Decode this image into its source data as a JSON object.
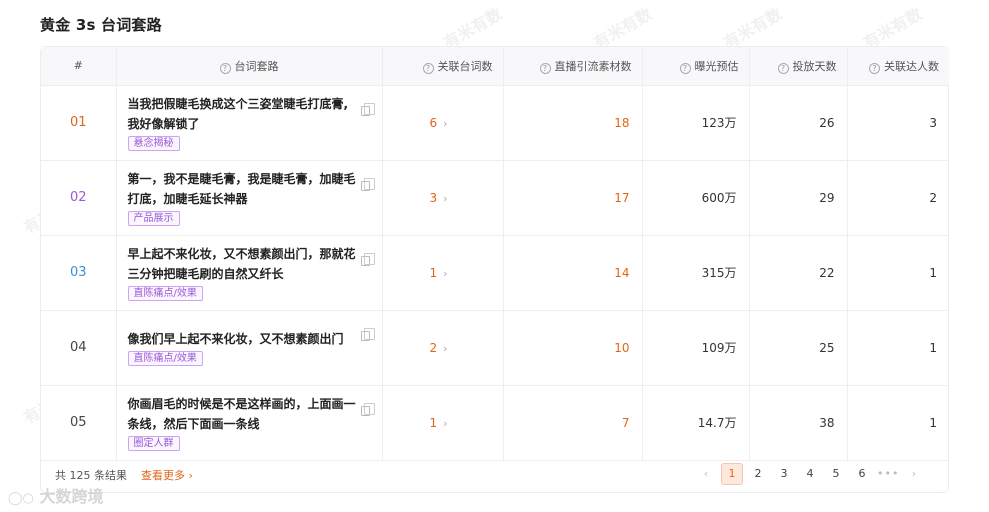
{
  "title": "黄金 3s 台词套路",
  "columns": {
    "idx": "#",
    "script": "台词套路",
    "linked_words": "关联台词数",
    "live_materials": "直播引流素材数",
    "exposure": "曝光预估",
    "days": "投放天数",
    "creators": "关联达人数"
  },
  "rows": [
    {
      "idx": "01",
      "idx_color": "#e0651c",
      "text": "当我把假睫毛换成这个三姿堂睫毛打底膏,我好像解锁了",
      "tag": "悬念揭秘",
      "linked": "6",
      "materials": "18",
      "exposure": "123万",
      "days": "26",
      "creators": "3"
    },
    {
      "idx": "02",
      "idx_color": "#9b59d6",
      "text": "第一，我不是睫毛膏，我是睫毛膏，加睫毛打底，加睫毛延长神器",
      "tag": "产品展示",
      "linked": "3",
      "materials": "17",
      "exposure": "600万",
      "days": "29",
      "creators": "2"
    },
    {
      "idx": "03",
      "idx_color": "#3b8fd8",
      "text": "早上起不来化妆，又不想素颜出门，那就花三分钟把睫毛刷的自然又纤长",
      "tag": "直陈痛点/效果",
      "linked": "1",
      "materials": "14",
      "exposure": "315万",
      "days": "22",
      "creators": "1"
    },
    {
      "idx": "04",
      "idx_color": "#444444",
      "text": "像我们早上起不来化妆，又不想素颜出门",
      "tag": "直陈痛点/效果",
      "linked": "2",
      "materials": "10",
      "exposure": "109万",
      "days": "25",
      "creators": "1"
    },
    {
      "idx": "05",
      "idx_color": "#444444",
      "text": "你画眉毛的时候是不是这样画的，上面画一条线，然后下面画一条线",
      "tag": "圈定人群",
      "linked": "1",
      "materials": "7",
      "exposure": "14.7万",
      "days": "38",
      "creators": "1"
    }
  ],
  "footer": {
    "total": "共 125 条结果",
    "more": "查看更多",
    "pages": [
      "1",
      "2",
      "3",
      "4",
      "5",
      "6"
    ],
    "dots": "•••",
    "active_page": "1"
  },
  "watermark": "大数跨境",
  "bg_watermark": "有米有数"
}
